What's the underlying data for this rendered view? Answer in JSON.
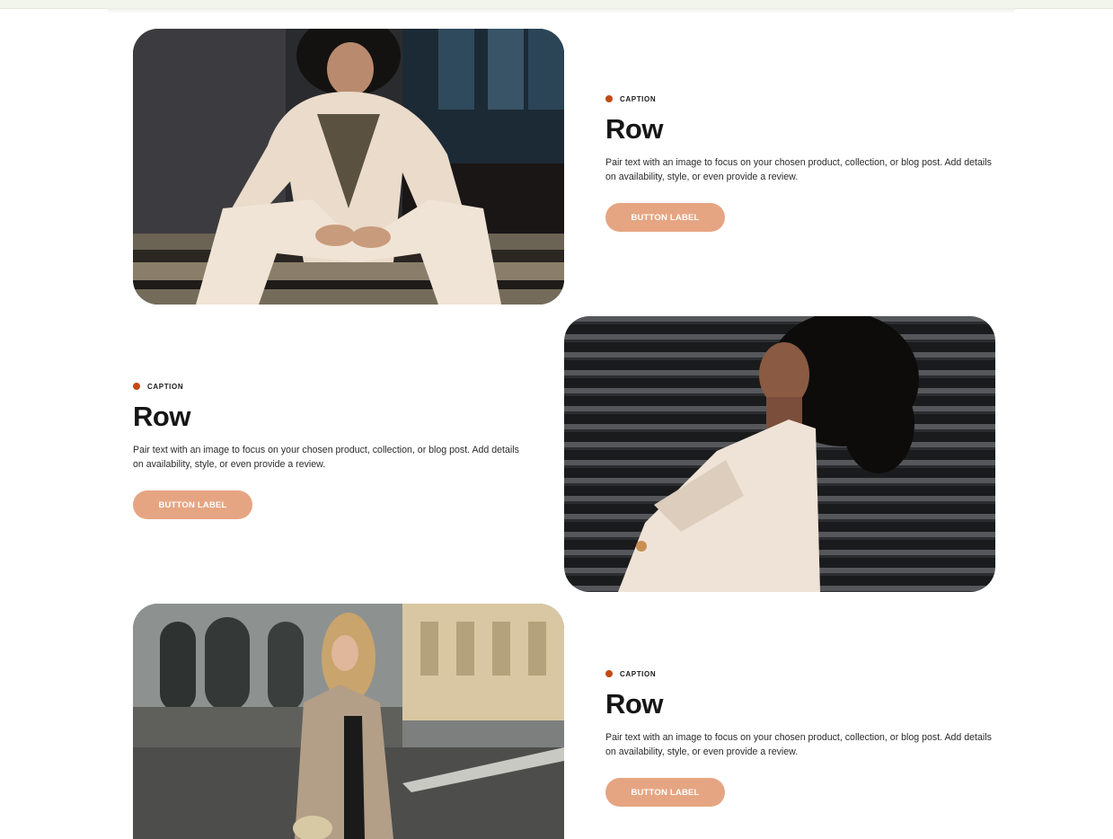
{
  "rows": [
    {
      "caption": "CAPTION",
      "heading": "Row",
      "body": "Pair text with an image to focus on your chosen product, collection, or blog post. Add details on availability, style, or even provide a review.",
      "button_label": "BUTTON LABEL"
    },
    {
      "caption": "CAPTION",
      "heading": "Row",
      "body": "Pair text with an image to focus on your chosen product, collection, or blog post. Add details on availability, style, or even provide a review.",
      "button_label": "BUTTON LABEL"
    },
    {
      "caption": "CAPTION",
      "heading": "Row",
      "body": "Pair text with an image to focus on your chosen product, collection, or blog post. Add details on availability, style, or even provide a review.",
      "button_label": "BUTTON LABEL"
    }
  ],
  "colors": {
    "accent_dot": "#c44a12",
    "button_bg": "#e6a582",
    "button_text": "#ffffff",
    "heading": "#161616"
  }
}
